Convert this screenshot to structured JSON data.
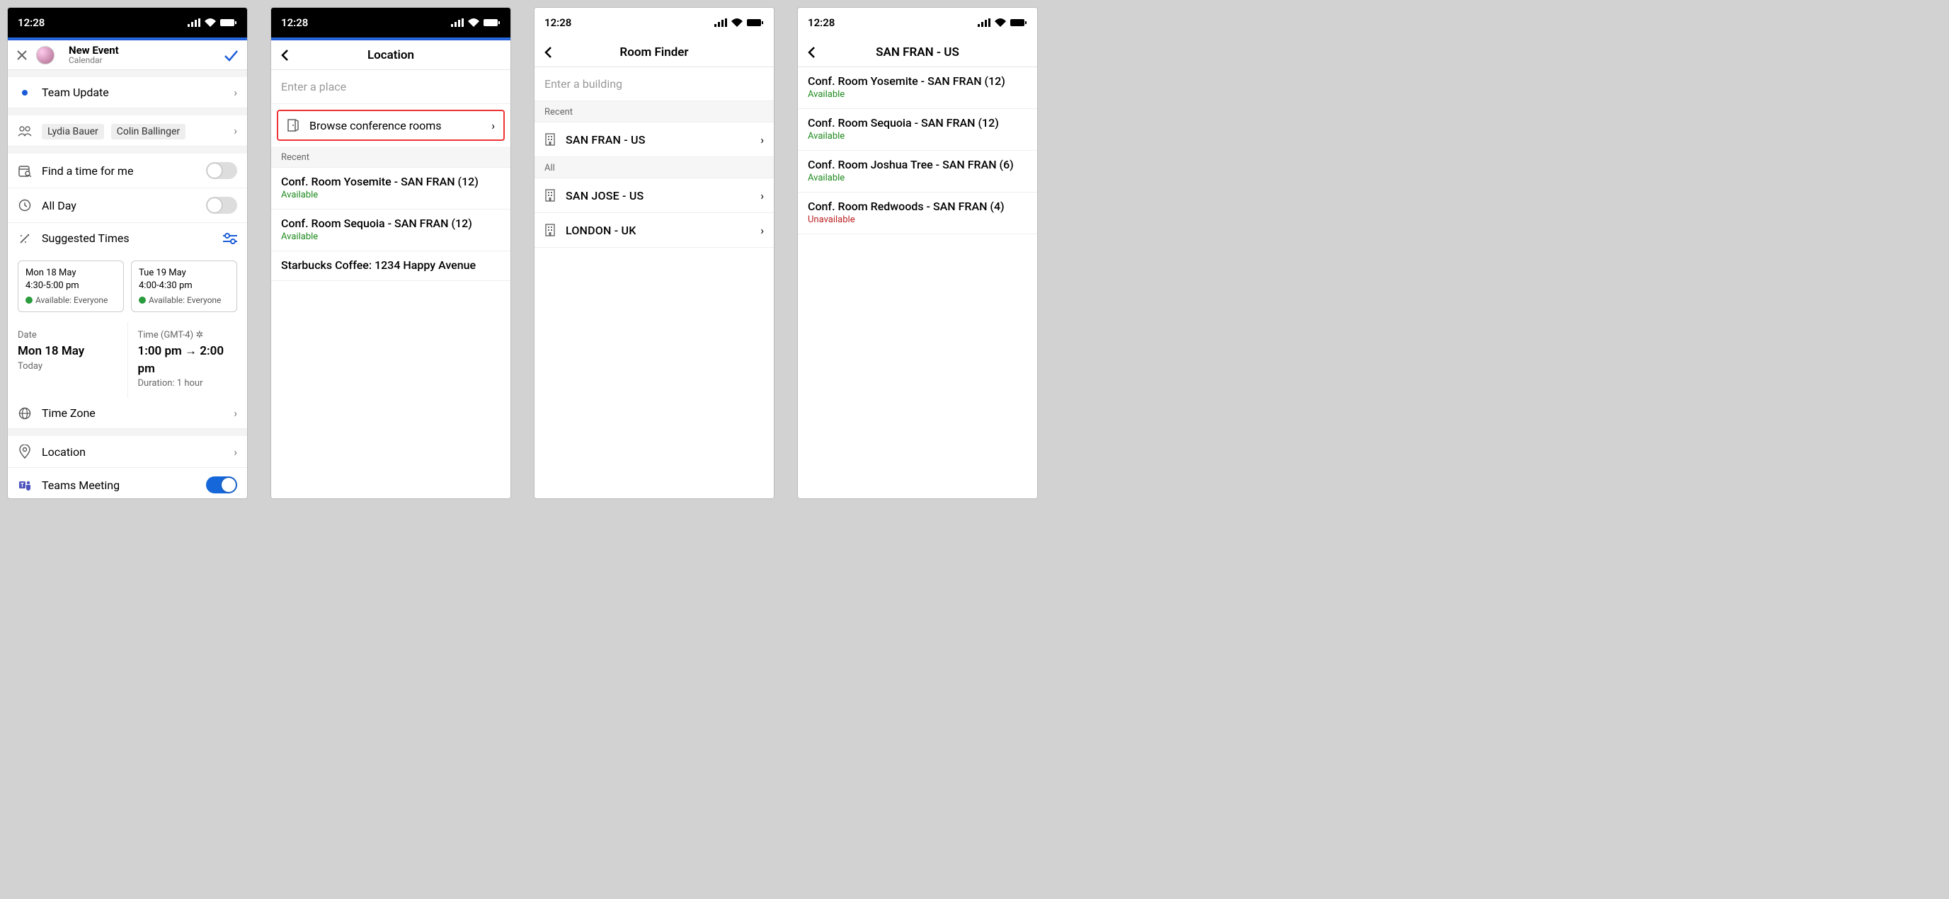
{
  "status": {
    "time": "12:28"
  },
  "s1": {
    "title": "New Event",
    "subtitle": "Calendar",
    "event_title": "Team Update",
    "attendees": [
      "Lydia Bauer",
      "Colin Ballinger"
    ],
    "find_time": "Find a time for me",
    "all_day": "All Day",
    "suggested_label": "Suggested Times",
    "suggestions": [
      {
        "date": "Mon 18 May",
        "range": "4:30-5:00 pm",
        "avail": "Available: Everyone"
      },
      {
        "date": "Tue 19 May",
        "range": "4:00-4:30 pm",
        "avail": "Available: Everyone"
      }
    ],
    "date_label": "Date",
    "date_value": "Mon 18 May",
    "date_rel": "Today",
    "time_label": "Time (GMT-4)",
    "time_start": "1:00 pm",
    "time_end": "2:00 pm",
    "duration": "Duration: 1 hour",
    "timezone": "Time Zone",
    "location": "Location",
    "teams": "Teams Meeting"
  },
  "s2": {
    "title": "Location",
    "placeholder": "Enter a place",
    "browse": "Browse conference rooms",
    "recent_label": "Recent",
    "rooms": [
      {
        "name": "Conf. Room Yosemite - SAN FRAN (12)",
        "status": "Available",
        "cls": "green"
      },
      {
        "name": "Conf. Room Sequoia - SAN FRAN (12)",
        "status": "Available",
        "cls": "green"
      }
    ],
    "other": "Starbucks Coffee: 1234 Happy Avenue"
  },
  "s3": {
    "title": "Room Finder",
    "placeholder": "Enter a building",
    "recent_label": "Recent",
    "all_label": "All",
    "recent": [
      "SAN FRAN - US"
    ],
    "all": [
      "SAN JOSE - US",
      "LONDON - UK"
    ]
  },
  "s4": {
    "title": "SAN FRAN - US",
    "rooms": [
      {
        "name": "Conf. Room Yosemite - SAN FRAN (12)",
        "status": "Available",
        "cls": "green"
      },
      {
        "name": "Conf. Room Sequoia - SAN FRAN (12)",
        "status": "Available",
        "cls": "green"
      },
      {
        "name": "Conf. Room Joshua Tree - SAN FRAN (6)",
        "status": "Available",
        "cls": "green"
      },
      {
        "name": "Conf. Room Redwoods - SAN FRAN (4)",
        "status": "Unavailable",
        "cls": "red"
      }
    ]
  }
}
